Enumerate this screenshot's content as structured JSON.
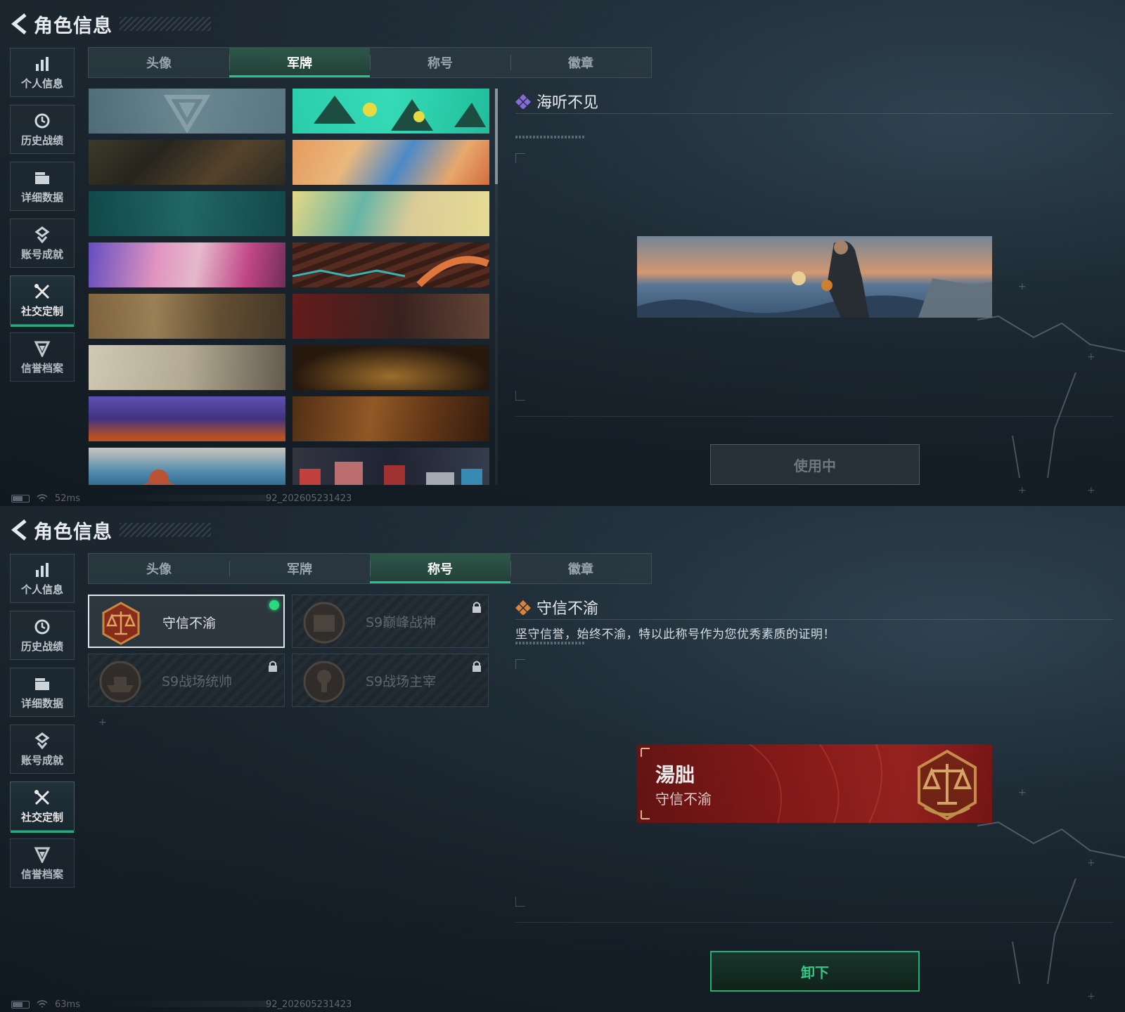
{
  "screen1": {
    "header": {
      "title": "角色信息"
    },
    "sidebar": [
      {
        "label": "个人信息",
        "icon": "bar-chart-icon"
      },
      {
        "label": "历史战绩",
        "icon": "clock-icon"
      },
      {
        "label": "详细数据",
        "icon": "folder-icon"
      },
      {
        "label": "账号成就",
        "icon": "trophy-icon"
      },
      {
        "label": "社交定制",
        "icon": "tools-icon",
        "active": true
      },
      {
        "label": "信誉档案",
        "icon": "shield-icon"
      }
    ],
    "tabs": [
      {
        "label": "头像"
      },
      {
        "label": "军牌",
        "active": true
      },
      {
        "label": "称号"
      },
      {
        "label": "徽章"
      }
    ],
    "detail": {
      "name": "海听不见"
    },
    "button": {
      "label": "使用中"
    },
    "footer": {
      "ping": "52ms",
      "version": "92_202605231423"
    }
  },
  "screen2": {
    "header": {
      "title": "角色信息"
    },
    "sidebar": [
      {
        "label": "个人信息",
        "icon": "bar-chart-icon"
      },
      {
        "label": "历史战绩",
        "icon": "clock-icon"
      },
      {
        "label": "详细数据",
        "icon": "folder-icon"
      },
      {
        "label": "账号成就",
        "icon": "trophy-icon"
      },
      {
        "label": "社交定制",
        "icon": "tools-icon",
        "active": true
      },
      {
        "label": "信誉档案",
        "icon": "shield-icon"
      }
    ],
    "tabs": [
      {
        "label": "头像"
      },
      {
        "label": "军牌"
      },
      {
        "label": "称号",
        "active": true
      },
      {
        "label": "徽章"
      }
    ],
    "titles": [
      {
        "name": "守信不渝",
        "selected": true,
        "locked": false
      },
      {
        "name": "S9巅峰战神",
        "locked": true
      },
      {
        "name": "S9战场统帅",
        "locked": true
      },
      {
        "name": "S9战场主宰",
        "locked": true
      }
    ],
    "detail": {
      "name": "守信不渝",
      "description": "坚守信誉，始终不渝，特以此称号作为您优秀素质的证明！"
    },
    "nameplate": {
      "player_name": "湯朏",
      "title": "守信不渝"
    },
    "button": {
      "label": "卸下"
    },
    "footer": {
      "ping": "63ms",
      "version": "92_202605231423"
    }
  },
  "colors": {
    "accent_green": "#23c48e",
    "active_dot": "#28e07f",
    "nameplate_red": "#8f1a18",
    "diamond_purple": "#8c6be0",
    "diamond_orange": "#e0853a"
  }
}
